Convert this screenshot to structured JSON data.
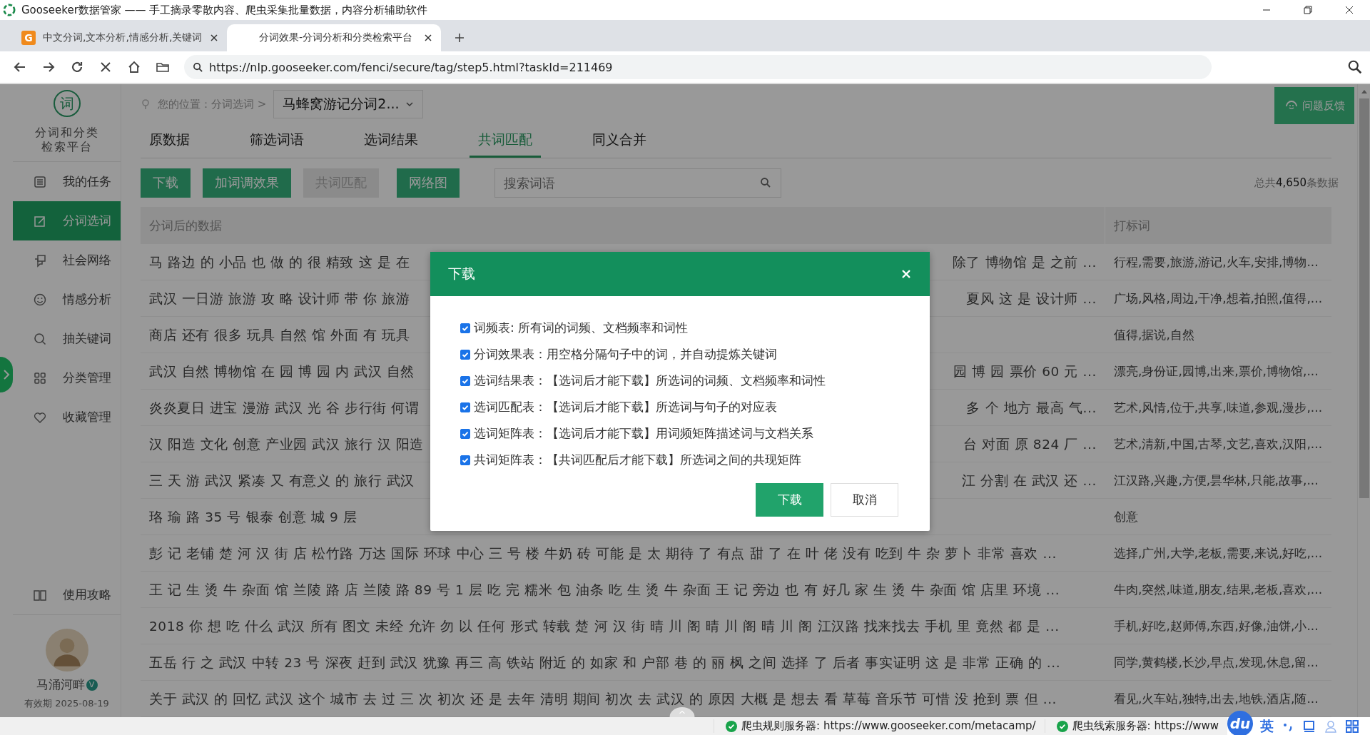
{
  "window": {
    "title": "Gooseeker数据管家 —— 手工摘录零散内容、爬虫采集批量数据，内容分析辅助软件"
  },
  "browser_tabs": [
    {
      "title": "中文分词,文本分析,情感分析,关键词",
      "selected": false,
      "favicon": "G"
    },
    {
      "title": "分词效果-分词分析和分类检索平台",
      "selected": true
    }
  ],
  "address": {
    "url": "https://nlp.gooseeker.com/fenci/secure/tag/step5.html?taskId=211469"
  },
  "sidebar": {
    "logo": "词",
    "platform": [
      "分词和分类",
      "检索平台"
    ],
    "items": [
      {
        "label": "我的任务",
        "selected": false
      },
      {
        "label": "分词选词",
        "selected": true
      },
      {
        "label": "社会网络",
        "selected": false
      },
      {
        "label": "情感分析",
        "selected": false
      },
      {
        "label": "抽关键词",
        "selected": false
      },
      {
        "label": "分类管理",
        "selected": false
      },
      {
        "label": "收藏管理",
        "selected": false
      }
    ],
    "guide": "使用攻略",
    "user": {
      "name": "马涌河畔",
      "badge": "V",
      "expiry": "有效期 2025-08-19"
    }
  },
  "breadcrumb": {
    "label": "您的位置：分词选词 >",
    "project": "马蜂窝游记分词2..."
  },
  "feedback": "问题反馈",
  "tabs": [
    {
      "label": "原数据",
      "selected": false
    },
    {
      "label": "筛选词语",
      "selected": false
    },
    {
      "label": "选词结果",
      "selected": false
    },
    {
      "label": "共词匹配",
      "selected": true
    },
    {
      "label": "同义合并",
      "selected": false
    }
  ],
  "toolbar": [
    {
      "label": "下载",
      "disabled": false
    },
    {
      "label": "加词调效果",
      "disabled": false
    },
    {
      "label": "共词匹配",
      "disabled": true
    },
    {
      "label": "网络图",
      "disabled": false
    }
  ],
  "search": {
    "placeholder": "搜索词语"
  },
  "total": "总共**4,650**条数据",
  "table": {
    "columns": [
      "分词后的数据",
      "打标词"
    ],
    "rows": [
      {
        "start": "马 路边 的 小品 也 做 的 很 精致 这 是 在",
        "end": "除了 博物馆 是 之前 ...",
        "tags": "行程,需要,旅游,游记,火车,安排,博物..."
      },
      {
        "start": "武汉 一日游 旅游 攻 略 设计师 带 你 旅游",
        "end": "夏风 这 是 设计师 ...",
        "tags": "广场,风格,周边,干净,想着,拍照,值得,..."
      },
      {
        "start": "商店 还有 很多 玩具 自然 馆 外面 有 玩具",
        "tags": "值得,据说,自然"
      },
      {
        "start": "武汉 自然 博物馆 在 园 博 园 内 武汉 自然",
        "end": "园 博 园 票价 60 元 ...",
        "tags": "漂亮,身份证,园博,出来,票价,博物馆,..."
      },
      {
        "start": "炎炎夏日 进宝 漫游 武汉 光 谷 步行街 何谓",
        "end": "多 个 地方 最高 气...",
        "tags": "艺术,风情,位于,共享,味道,参观,漫步,..."
      },
      {
        "start": "汉 阳造 文化 创意 产业园 武汉 旅行 汉 阳造",
        "end": "台 对面 原 824 厂 ...",
        "tags": "艺术,清新,中国,古琴,文艺,喜欢,汉阳,..."
      },
      {
        "start": "三 天 游 武汉 紧凑 又 有意义 的 旅行 武汉",
        "end": "江 分割 在 武汉 还 ...",
        "tags": "江汉路,兴趣,方便,昙华林,只能,故事,..."
      },
      {
        "start": "珞 瑜 路 35 号 银泰 创意 城 9 层",
        "tags": "创意"
      },
      {
        "start": "彭 记 老铺 楚 河 汉 街 店 松竹路 万达 国际 环球 中心 三 号 楼 牛奶 砖 可能 是 太 期待 了 有点 甜 了 在 叶 佬 没有 吃到 牛 杂 萝卜 非常 喜欢 ...",
        "tags": "选择,广州,大学,老板,需要,来说,好吃,..."
      },
      {
        "start": "王 记 生 烫 牛 杂面 馆 兰陵 路 店 兰陵 路 89 号 1 层 吃 完 糯米 包 油条 吃 生 烫 牛 杂面 王 记 旁边 也 有 好几 家 生 烫 牛 杂面 馆 店里 环境 ...",
        "tags": "牛肉,突然,味道,朋友,结果,老板,喜欢,..."
      },
      {
        "start": "2018 你 想 吃 什么 武汉 所有 图文 未经 允许 勿 以 任何 形式 转载 楚 河 汉 街 晴 川 阁 晴 川 阁 晴 川 阁 江汉路 找来找去 手机 里 竟然 都 是 ...",
        "tags": "手机,好吃,赵师傅,东西,好像,油饼,小..."
      },
      {
        "start": "五岳 行 之 武汉 中转 23 号 深夜 赶到 武汉 犹豫 再三 高 铁站 附近 的 如家 和 户部 巷 的 丽 枫 之间 选择 了 后者 事实证明 这 是 非常 正确 的 ...",
        "tags": "同学,黄鹤楼,长沙,早点,发现,休息,留..."
      },
      {
        "start": "关于 武汉 的 回忆 武汉 这个 城市 去 过 三 次 初次 还 是 去年 清明 期间 初次 去 武汉 的 原因 大概 是 想去 看 草莓 音乐节 可惜 没 抢到 票 但 ...",
        "tags": "看见,火车站,独特,出去,地铁,酒店,随..."
      }
    ]
  },
  "dialog": {
    "title": "下载",
    "options": [
      {
        "label": "词频表: 所有词的词频、文档频率和词性",
        "checked": true
      },
      {
        "label": "分词效果表：用空格分隔句子中的词，并自动提炼关键词",
        "checked": true
      },
      {
        "label": "选词结果表：【选词后才能下载】所选词的词频、文档频率和词性",
        "checked": true
      },
      {
        "label": "选词匹配表：【选词后才能下载】所选词与句子的对应表",
        "checked": true
      },
      {
        "label": "选词矩阵表：【选词后才能下载】用词频矩阵描述词与文档关系",
        "checked": true
      },
      {
        "label": "共词矩阵表：【共词匹配后才能下载】所选词之间的共现矩阵",
        "checked": true
      }
    ],
    "buttons": [
      {
        "label": "下载",
        "kind": "primary"
      },
      {
        "label": "取消",
        "kind": "secondary"
      }
    ]
  },
  "status_bar": [
    {
      "text": "爬虫规则服务器: https://www.gooseeker.com/metacamp/"
    },
    {
      "text": "爬虫线索服务器: https://www"
    }
  ],
  "ime": {
    "logo": "du",
    "mode": "英"
  }
}
